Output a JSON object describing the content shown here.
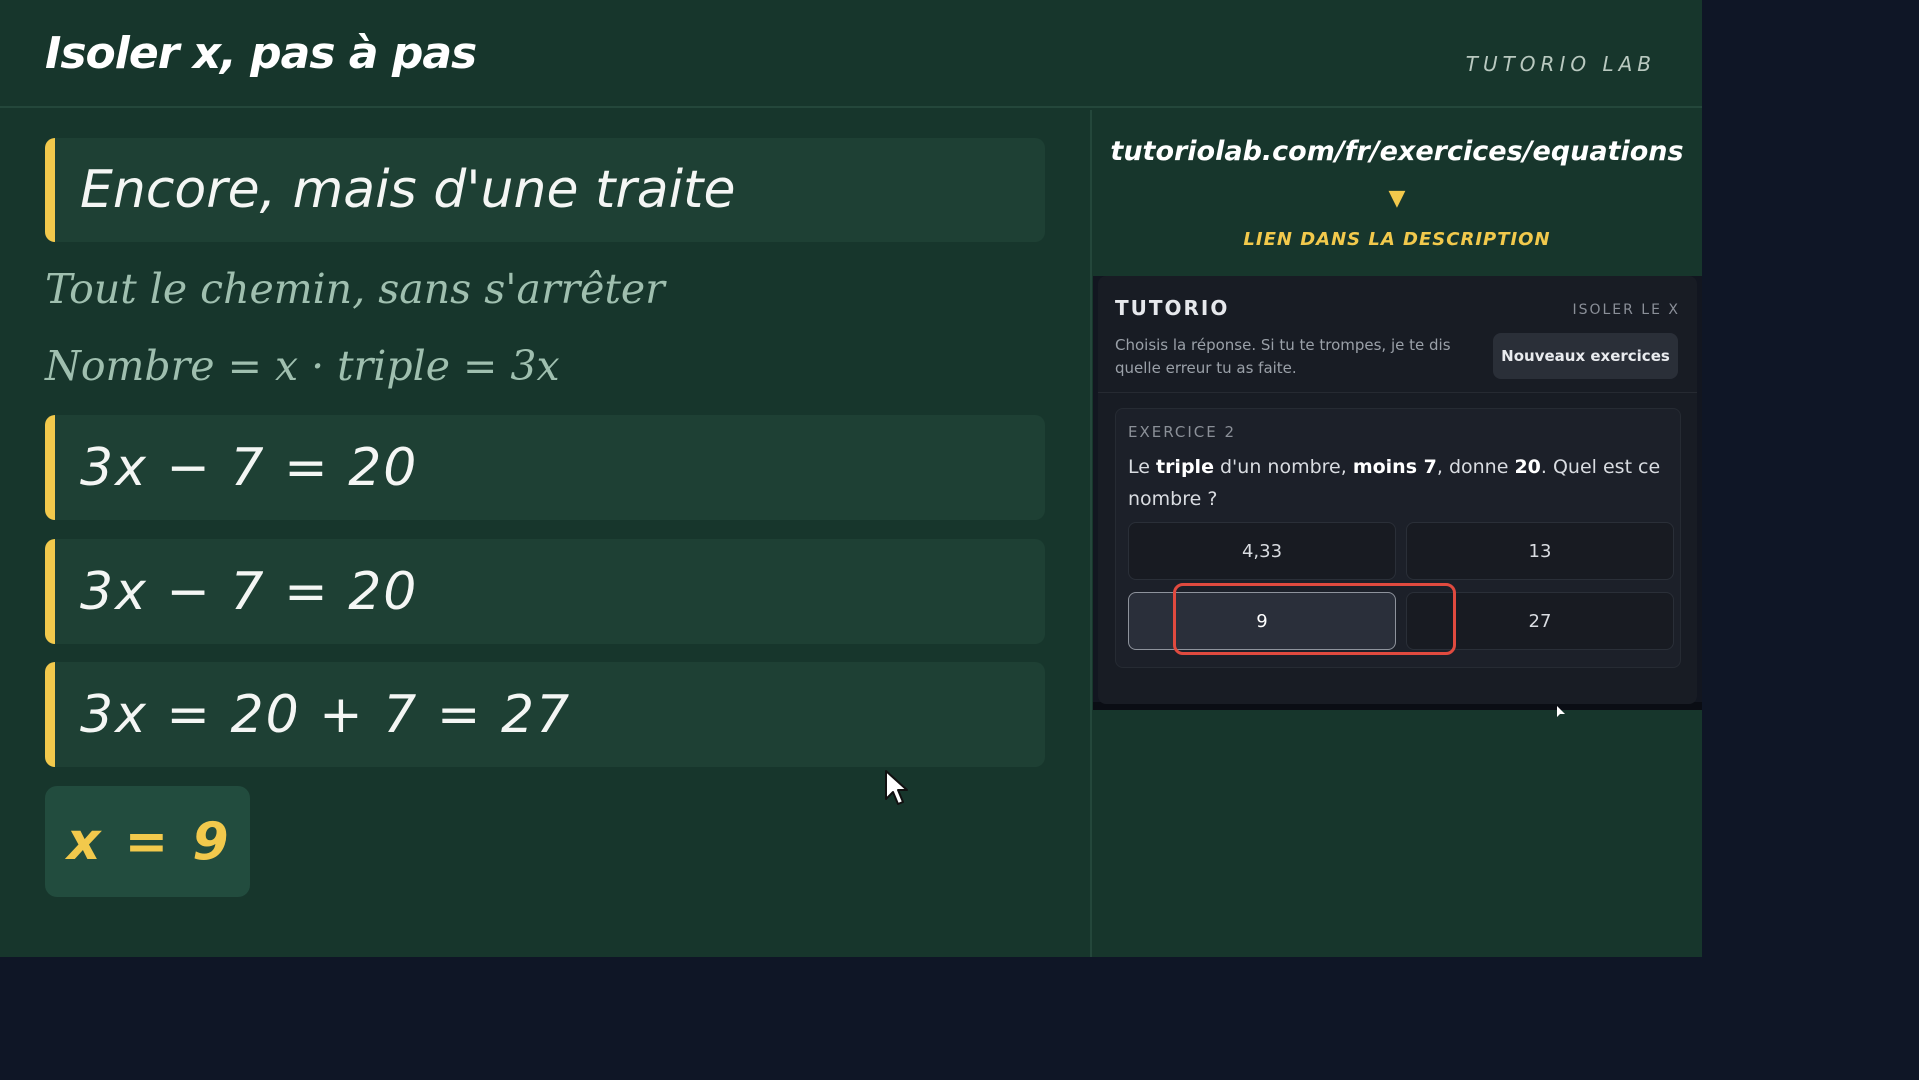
{
  "header": {
    "title": "Isoler x, pas à pas",
    "brand": "TUTORIO LAB"
  },
  "lesson": {
    "heading": "Encore, mais d'une traite",
    "subtitle": "Tout le chemin, sans s'arrêter",
    "definition": "Nombre = x  ·  triple = 3x",
    "steps": [
      "3x − 7 = 20",
      "3x − 7 = 20",
      "3x = 20 + 7 = 27"
    ],
    "answer": "x = 9"
  },
  "promo": {
    "url": "tutoriolab.com/fr/exercices/equations",
    "arrow": "▼",
    "link_caption": "LIEN DANS LA DESCRIPTION"
  },
  "widget": {
    "title": "TUTORIO",
    "tag": "ISOLER LE X",
    "description": "Choisis la réponse. Si tu te trompes, je te dis quelle erreur tu as faite.",
    "new_button": "Nouveaux exercices",
    "exercise": {
      "label": "EXERCICE 2",
      "question_parts": [
        "Le ",
        "triple",
        " d'un nombre, ",
        "moins 7",
        ", donne ",
        "20",
        ". Quel est ce nombre ?"
      ],
      "options": [
        "4,33",
        "13",
        "9",
        "27"
      ],
      "selected": "9"
    }
  },
  "colors": {
    "board": "#17362c",
    "accent": "#f2c94c",
    "highlight": "#e04a3f"
  }
}
